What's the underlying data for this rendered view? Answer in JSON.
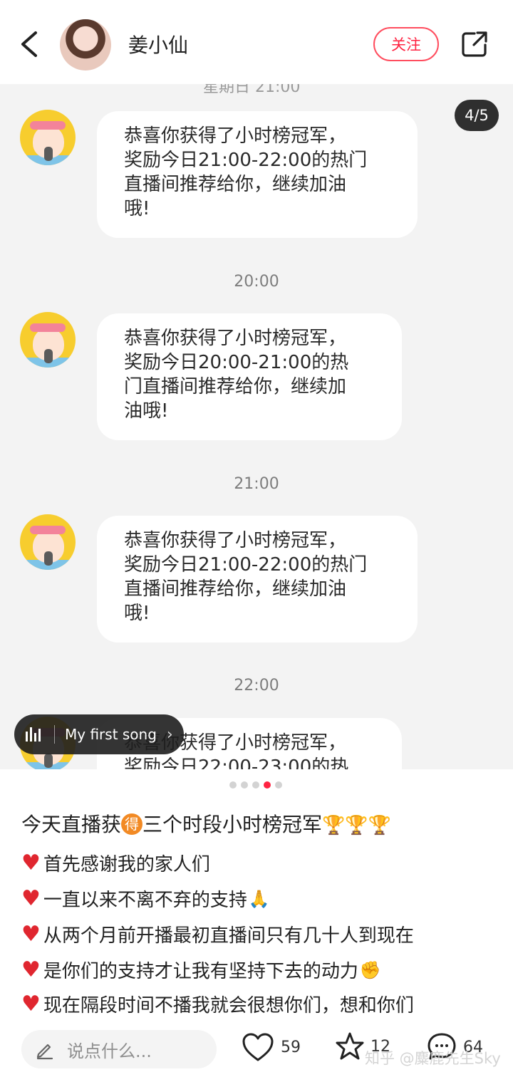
{
  "header": {
    "username": "姜小仙",
    "follow_label": "关注"
  },
  "image": {
    "page_indicator": "4/5",
    "cut_time": "星期日 21:00",
    "messages": [
      {
        "text": "恭喜你获得了小时榜冠军，\n奖励今日21:00-22:00的热门\n直播间推荐给你，继续加油\n哦!"
      },
      {
        "time": "20:00",
        "text": "恭喜你获得了小时榜冠军，\n奖励今日20:00-21:00的热\n门直播间推荐给你，继续加\n油哦!"
      },
      {
        "time": "21:00",
        "text": "恭喜你获得了小时榜冠军，\n奖励今日21:00-22:00的热门\n直播间推荐给你，继续加油\n哦!"
      },
      {
        "time": "22:00",
        "text": "恭喜你获得了小时榜冠军，\n奖励今日22:00-23:00的热"
      }
    ],
    "music_pill": "My first song",
    "carousel_total": 5,
    "carousel_active": 4
  },
  "post": {
    "title_before": "今天直播获",
    "title_badge": "得",
    "title_after": "三个时段小时榜冠军",
    "lines": [
      {
        "text": "首先感谢我的家人们",
        "emoji": ""
      },
      {
        "text": "一直以来不离不弃的支持",
        "emoji": "🙏"
      },
      {
        "text": "从两个月前开播最初直播间只有几十人到现在",
        "emoji": ""
      },
      {
        "text": "是你们的支持才让我有坚持下去的动力",
        "emoji": "✊"
      },
      {
        "text": "现在隔段时间不播我就会很想你们，想和你们",
        "emoji": ""
      }
    ]
  },
  "bottom_bar": {
    "comment_placeholder": "说点什么...",
    "likes": "59",
    "favorites": "12",
    "comments": "64"
  },
  "watermark": "知乎 @麋鹿先生Sky",
  "colors": {
    "accent": "#ff2442",
    "chat_bg": "#f3f3f3",
    "heart": "#e0262f"
  }
}
